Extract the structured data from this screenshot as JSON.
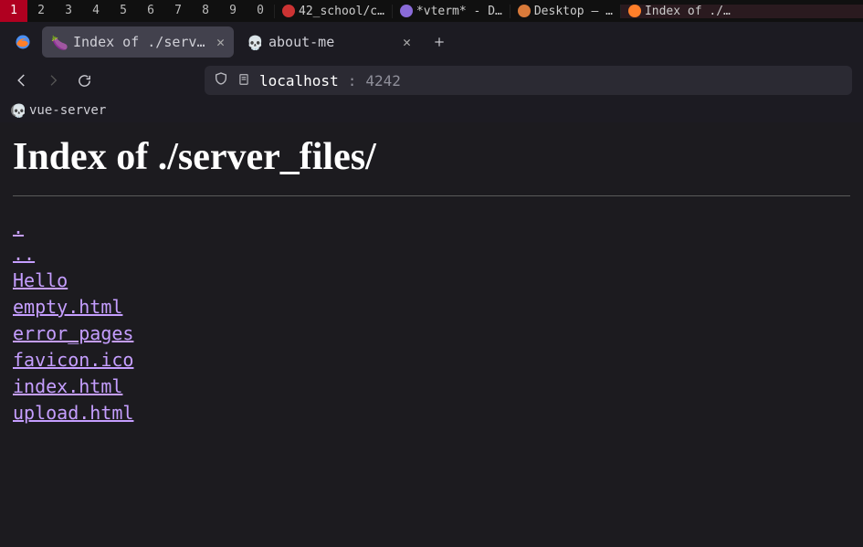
{
  "taskbar": {
    "workspaces": [
      "1",
      "2",
      "3",
      "4",
      "5",
      "6",
      "7",
      "8",
      "9",
      "0"
    ],
    "active_ws_index": 0,
    "apps": [
      {
        "label": "42_school/c…",
        "icon_color": "#c33"
      },
      {
        "label": "*vterm* - D…",
        "icon_color": "#8a6bd9"
      },
      {
        "label": "Desktop — …",
        "icon_color": "#d97a3a"
      },
      {
        "label": "Index of ./…",
        "icon_color": "#ff7f2a"
      }
    ]
  },
  "tabs": [
    {
      "label": "Index of ./server_files/",
      "icon": "eggplant",
      "active": true
    },
    {
      "label": "about-me",
      "icon": "skull",
      "active": false
    }
  ],
  "url": {
    "host": "localhost",
    "port": "4242"
  },
  "bookmark": {
    "label": "vue-server"
  },
  "page": {
    "heading": "Index of ./server_files/",
    "links": [
      ".",
      "..",
      "Hello",
      "empty.html",
      "error_pages",
      "favicon.ico",
      "index.html",
      "upload.html"
    ]
  }
}
